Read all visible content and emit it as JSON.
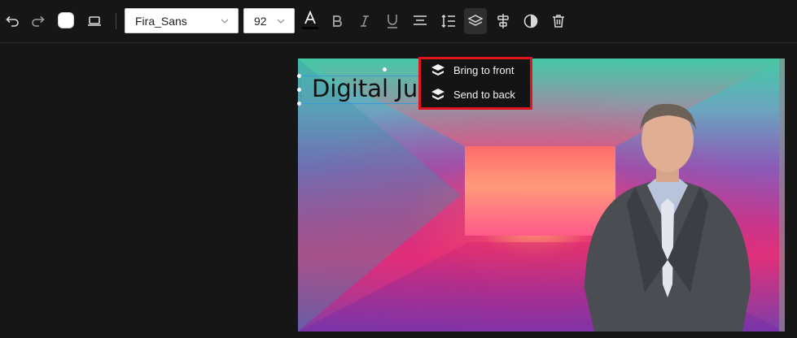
{
  "toolbar": {
    "font_family": "Fira_Sans",
    "font_size": "92",
    "text_color": "#ffffff"
  },
  "canvas": {
    "text_content": "Digital Jus"
  },
  "layer_menu": {
    "items": [
      {
        "label": "Bring to front",
        "icon": "layers-up-icon"
      },
      {
        "label": "Send to back",
        "icon": "layers-down-icon"
      }
    ],
    "highlight_color": "#e0151b"
  },
  "colors": {
    "background": "#161616",
    "selection": "#3a9ad9"
  }
}
